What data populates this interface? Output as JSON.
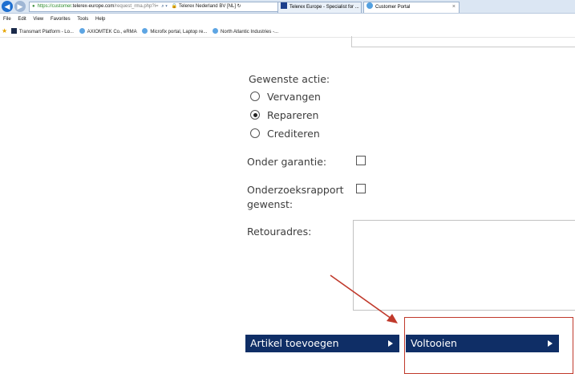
{
  "browser": {
    "address": {
      "url_prefix": "https://customer.",
      "url_domain": "telerex-europe.com",
      "url_path": "/request_rma.php?i=",
      "tools": "⌕ ▾",
      "site_name": "Telerex Nederland BV [NL] ↻"
    },
    "tabs": [
      {
        "label": "Telerex Europe - Specialist for ..."
      },
      {
        "label": "Customer Portal",
        "close": "×"
      }
    ],
    "menu": [
      "File",
      "Edit",
      "View",
      "Favorites",
      "Tools",
      "Help"
    ],
    "favorites": [
      {
        "label": "Transmart Platform - Lo..."
      },
      {
        "label": "AXIOMTEK Co., eRMA"
      },
      {
        "label": "Microfix portal, Laptop re..."
      },
      {
        "label": "North Atlantic Industries -..."
      }
    ]
  },
  "form": {
    "action_label": "Gewenste actie:",
    "options": [
      {
        "label": "Vervangen",
        "selected": false
      },
      {
        "label": "Repareren",
        "selected": true
      },
      {
        "label": "Crediteren",
        "selected": false
      }
    ],
    "warranty_label": "Onder garantie:",
    "warranty_checked": false,
    "report_label_line1": "Onderzoeksrapport",
    "report_label_line2": "gewenst:",
    "report_checked": false,
    "return_address_label": "Retouradres:",
    "return_address_value": ""
  },
  "buttons": {
    "add_article": "Artikel toevoegen",
    "finish": "Voltooien"
  },
  "colors": {
    "button_bg": "#0f2e66",
    "annotation": "#c0392b"
  }
}
